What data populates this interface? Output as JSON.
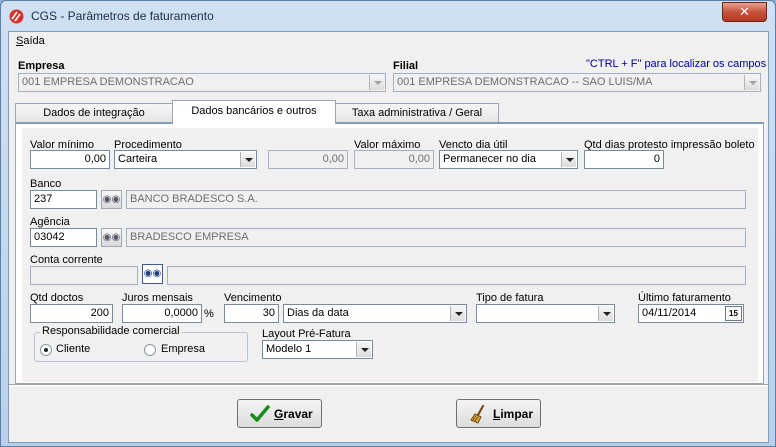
{
  "window": {
    "title": "CGS - Parâmetros de faturamento",
    "close_label": "✕"
  },
  "menu": {
    "items": [
      {
        "accel": "S",
        "rest": "aída"
      }
    ]
  },
  "empresa": {
    "label": "Empresa",
    "value": "001 EMPRESA DEMONSTRACAO"
  },
  "filial": {
    "label": "Filial",
    "value": "001 EMPRESA DEMONSTRACAO -- SAO LUIS/MA"
  },
  "hint": "\"CTRL + F\" para localizar os campos",
  "tabs": [
    {
      "label": "Dados de integração",
      "active": false
    },
    {
      "label": "Dados bancários e outros",
      "active": true
    },
    {
      "label": "Taxa administrativa / Geral",
      "active": false
    }
  ],
  "form": {
    "valor_minimo": {
      "label": "Valor mínimo",
      "value": "0,00"
    },
    "procedimento": {
      "label": "Procedimento",
      "value": "Carteira"
    },
    "procedimento_valor": {
      "value": "0,00"
    },
    "valor_maximo": {
      "label": "Valor máximo",
      "value": "0,00"
    },
    "vencto_dia_util": {
      "label": "Vencto dia útil",
      "value": "Permanecer no dia"
    },
    "qtd_dias_protesto": {
      "label": "Qtd dias protesto impressão boleto",
      "value": "0"
    },
    "banco": {
      "label": "Banco",
      "code": "237",
      "name": "BANCO BRADESCO S.A."
    },
    "agencia": {
      "label": "Agência",
      "code": "03042",
      "name": "BRADESCO EMPRESA"
    },
    "conta_corrente": {
      "label": "Conta corrente",
      "code": "",
      "name": ""
    },
    "qtd_doctos": {
      "label": "Qtd doctos",
      "value": "200"
    },
    "juros_mensais": {
      "label": "Juros mensais",
      "value": "0,0000",
      "unit": "%"
    },
    "vencimento": {
      "label": "Vencimento",
      "value": "30",
      "mode": "Dias da data"
    },
    "tipo_fatura": {
      "label": "Tipo de fatura",
      "value": ""
    },
    "ultimo_faturamento": {
      "label": "Último faturamento",
      "value": "04/11/2014",
      "calendar_label": "15"
    },
    "responsabilidade": {
      "label": "Responsabilidade comercial",
      "options": [
        "Cliente",
        "Empresa"
      ],
      "selected": "Cliente"
    },
    "layout_pre_fatura": {
      "label": "Layout Pré-Fatura",
      "value": "Modelo 1"
    }
  },
  "buttons": {
    "gravar": {
      "accel": "G",
      "rest": "ravar"
    },
    "limpar": {
      "accel": "L",
      "rest": "impar"
    }
  },
  "colors": {
    "hint": "#0000a0",
    "title_close": "#c7533c",
    "check": "#1a8a1a"
  }
}
